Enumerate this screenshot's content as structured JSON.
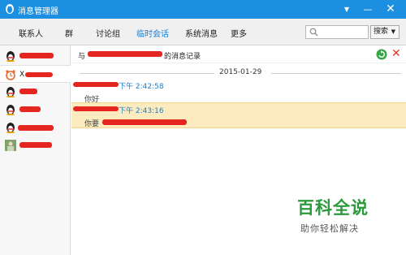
{
  "window": {
    "title": "消息管理器",
    "controls": {
      "dropdown": "▼",
      "minimize": "—",
      "close": "✕"
    }
  },
  "tabs": [
    {
      "label": "联系人",
      "active": false
    },
    {
      "label": "群",
      "active": false
    },
    {
      "label": "讨论组",
      "active": false
    },
    {
      "label": "临时会话",
      "active": true
    },
    {
      "label": "系统消息",
      "active": false
    },
    {
      "label": "更多",
      "active": false
    }
  ],
  "search": {
    "placeholder": "",
    "button_label": "搜索",
    "button_arrow": "▼"
  },
  "sidebar": {
    "contacts": [
      {
        "name": "",
        "icon": "penguin-icon"
      },
      {
        "name": "X",
        "icon": "alarm-icon",
        "selected": true
      },
      {
        "name": "",
        "icon": "penguin-icon"
      },
      {
        "name": "",
        "icon": "penguin-icon"
      },
      {
        "name": "",
        "icon": "penguin-icon"
      },
      {
        "name": "",
        "icon": "photo-avatar-icon"
      }
    ]
  },
  "history": {
    "header_prefix": "与",
    "header_suffix": "的消息记录",
    "date": "2015-01-29",
    "messages": [
      {
        "time": "下午 2:42:58",
        "text": "你好",
        "highlighted": false
      },
      {
        "time": "下午 2:43:16",
        "text": "你要",
        "highlighted": true
      }
    ]
  },
  "watermark": {
    "title": "百科全说",
    "subtitle": "助你轻松解决"
  },
  "colors": {
    "titlebar": "#1c8fe0",
    "accent": "#1a7ed0",
    "highlight": "#fcebbf",
    "redaction": "#e5251f",
    "watermark": "#2a9a3b"
  }
}
